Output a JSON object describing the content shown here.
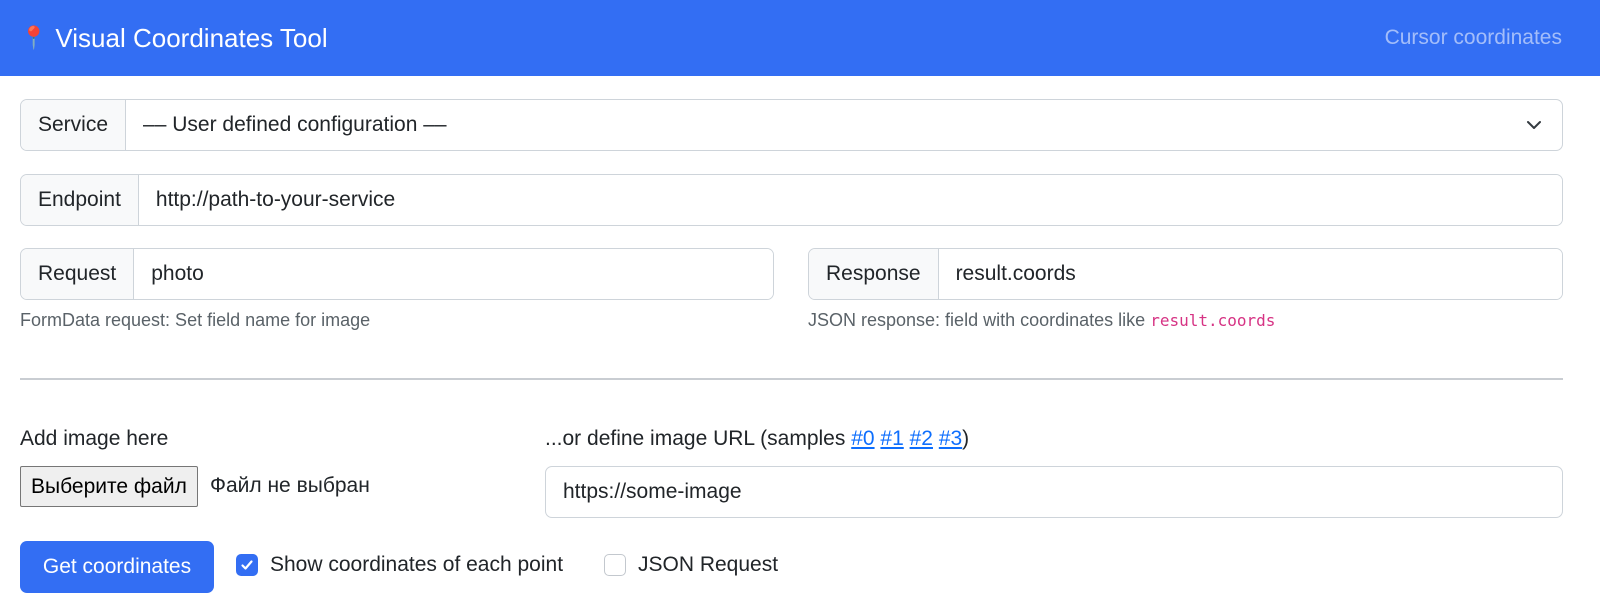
{
  "navbar": {
    "brand_icon": "map-pin-icon",
    "brand_title": "Visual Coordinates Tool",
    "link": "Cursor coordinates",
    "background": "#336ef3"
  },
  "form": {
    "service": {
      "label": "Service",
      "selected": "–– User defined configuration ––"
    },
    "endpoint": {
      "label": "Endpoint",
      "value": "http://path-to-your-service"
    },
    "request": {
      "label": "Request",
      "value": "photo",
      "help": "FormData request: Set field name for image"
    },
    "response": {
      "label": "Response",
      "value": "result.coords",
      "help_prefix": "JSON response: field with coordinates like",
      "help_code": "result.coords"
    }
  },
  "image": {
    "add_label": "Add image here",
    "file_button": "Выберите файл",
    "file_status": "Файл не выбран",
    "url_label_prefix": "...or define image URL (samples",
    "samples": [
      "#0",
      "#1",
      "#2",
      "#3"
    ],
    "url_label_suffix": ")",
    "url_value": "https://some-image"
  },
  "actions": {
    "submit": "Get coordinates",
    "show_coords": {
      "label": "Show coordinates of each point",
      "checked": true
    },
    "json_request": {
      "label": "JSON Request",
      "checked": false
    }
  }
}
